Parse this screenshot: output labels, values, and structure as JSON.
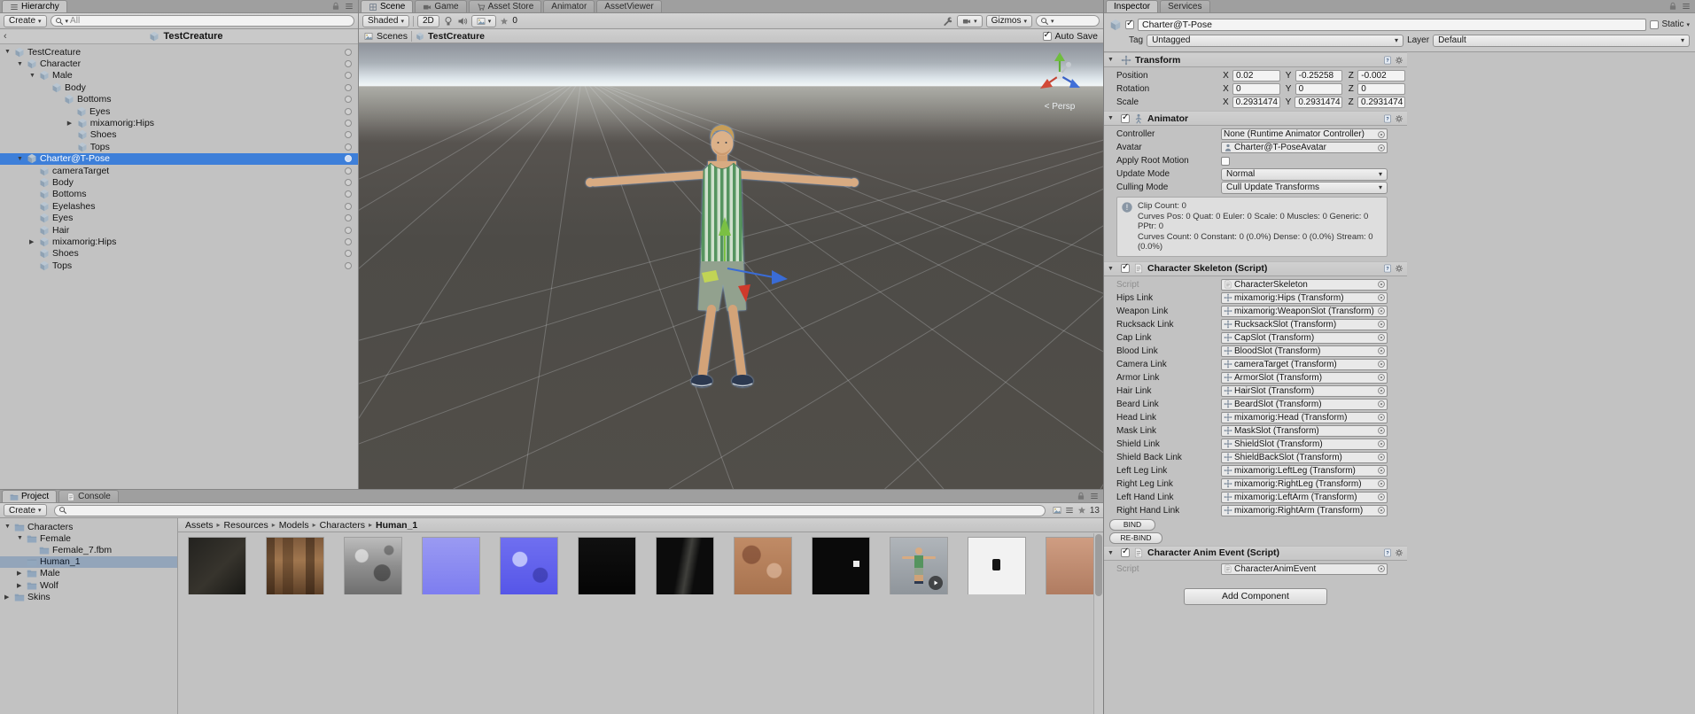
{
  "colors": {
    "selection_blue": "#3d7fd9",
    "project_selection": "#93a5ba",
    "gizmo_green": "#7ac043",
    "gizmo_red": "#cf3a2c",
    "gizmo_blue": "#3a6cd6",
    "shirt_green": "#55945f"
  },
  "hierarchy": {
    "tab": "Hierarchy",
    "create_button": "Create",
    "search_value": "All",
    "header_title": "TestCreature",
    "tree": [
      {
        "label": "TestCreature"
      },
      {
        "label": "Character"
      },
      {
        "label": "Male"
      },
      {
        "label": "Body"
      },
      {
        "label": "Bottoms"
      },
      {
        "label": "Eyes"
      },
      {
        "label": "mixamorig:Hips"
      },
      {
        "label": "Shoes"
      },
      {
        "label": "Tops"
      },
      {
        "label": "Charter@T-Pose",
        "selected": true
      },
      {
        "label": "cameraTarget"
      },
      {
        "label": "Body"
      },
      {
        "label": "Bottoms"
      },
      {
        "label": "Eyelashes"
      },
      {
        "label": "Eyes"
      },
      {
        "label": "Hair"
      },
      {
        "label": "mixamorig:Hips"
      },
      {
        "label": "Shoes"
      },
      {
        "label": "Tops"
      }
    ]
  },
  "scene": {
    "tabs": [
      "Scene",
      "Game",
      "Asset Store",
      "Animator",
      "AssetViewer"
    ],
    "toolbar": {
      "shading": "Shaded",
      "mode_2d": "2D",
      "fx_count": "0",
      "gizmos": "Gizmos"
    },
    "breadcrumb": {
      "scenes_label": "Scenes",
      "scene_name": "TestCreature",
      "autosave_label": "Auto Save"
    },
    "viewport": {
      "persp_label": "< Persp"
    }
  },
  "inspector": {
    "tabs": [
      "Inspector",
      "Services"
    ],
    "header": {
      "name": "Charter@T-Pose",
      "static_label": "Static",
      "tag_label": "Tag",
      "tag_value": "Untagged",
      "layer_label": "Layer",
      "layer_value": "Default"
    },
    "axis_labels": [
      "X",
      "Y",
      "Z"
    ],
    "transform": {
      "title": "Transform",
      "rows": [
        {
          "label": "Position",
          "x": "0.02",
          "y": "-0.25258",
          "z": "-0.002"
        },
        {
          "label": "Rotation",
          "x": "0",
          "y": "0",
          "z": "0"
        },
        {
          "label": "Scale",
          "x": "0.2931474",
          "y": "0.2931474",
          "z": "0.2931474"
        }
      ]
    },
    "animator": {
      "title": "Animator",
      "labels": {
        "controller": "Controller",
        "avatar": "Avatar",
        "root_motion": "Apply Root Motion",
        "update_mode": "Update Mode",
        "culling_mode": "Culling Mode"
      },
      "controller_value": "None (Runtime Animator Controller)",
      "avatar_value": "Charter@T-PoseAvatar",
      "update_mode_value": "Normal",
      "culling_mode_value": "Cull Update Transforms",
      "info_lines": [
        "Clip Count: 0",
        "Curves Pos: 0 Quat: 0 Euler: 0 Scale: 0 Muscles: 0 Generic: 0",
        "PPtr: 0",
        "Curves Count: 0 Constant: 0 (0.0%) Dense: 0 (0.0%) Stream: 0 (0.0%)"
      ]
    },
    "skeleton": {
      "title": "Character Skeleton (Script)",
      "script_label": "Script",
      "script_value": "CharacterSkeleton",
      "rows": [
        {
          "label": "Hips Link",
          "value": "mixamorig:Hips (Transform)"
        },
        {
          "label": "Weapon Link",
          "value": "mixamorig:WeaponSlot (Transform)"
        },
        {
          "label": "Rucksack Link",
          "value": "RucksackSlot (Transform)"
        },
        {
          "label": "Cap Link",
          "value": "CapSlot (Transform)"
        },
        {
          "label": "Blood Link",
          "value": "BloodSlot (Transform)"
        },
        {
          "label": "Camera Link",
          "value": "cameraTarget (Transform)"
        },
        {
          "label": "Armor Link",
          "value": "ArmorSlot (Transform)"
        },
        {
          "label": "Hair Link",
          "value": "HairSlot (Transform)"
        },
        {
          "label": "Beard Link",
          "value": "BeardSlot (Transform)"
        },
        {
          "label": "Head Link",
          "value": "mixamorig:Head (Transform)"
        },
        {
          "label": "Mask Link",
          "value": "MaskSlot (Transform)"
        },
        {
          "label": "Shield Link",
          "value": "ShieldSlot (Transform)"
        },
        {
          "label": "Shield Back Link",
          "value": "ShieldBackSlot (Transform)"
        },
        {
          "label": "Left Leg Link",
          "value": "mixamorig:LeftLeg (Transform)"
        },
        {
          "label": "Right Leg Link",
          "value": "mixamorig:RightLeg (Transform)"
        },
        {
          "label": "Left Hand Link",
          "value": "mixamorig:LeftArm (Transform)"
        },
        {
          "label": "Right Hand Link",
          "value": "mixamorig:RightArm (Transform)"
        }
      ],
      "bind_button": "BIND",
      "rebind_button": "RE-BIND"
    },
    "anim_event": {
      "title": "Character Anim Event (Script)",
      "script_label": "Script",
      "script_value": "CharacterAnimEvent"
    },
    "add_component": "Add Component"
  },
  "project": {
    "tabs": [
      "Project",
      "Console"
    ],
    "create_button": "Create",
    "asset_count": "13",
    "folders": [
      {
        "label": "Characters"
      },
      {
        "label": "Female"
      },
      {
        "label": "Female_7.fbm"
      },
      {
        "label": "Human_1",
        "selected": true
      },
      {
        "label": "Male"
      },
      {
        "label": "Wolf"
      },
      {
        "label": "Skins"
      }
    ],
    "breadcrumb": [
      "Assets",
      "Resources",
      "Models",
      "Characters",
      "Human_1"
    ],
    "thumbs": [
      {
        "name": "texture-dark",
        "bg": "linear-gradient(135deg,#23221f,#37342d 55%,#181815)"
      },
      {
        "name": "texture-hair-atlas",
        "bg": "linear-gradient(180deg,#7e5a3c,#a0764e 40%,#5d4028)"
      },
      {
        "name": "texture-cloth-gray",
        "bg": "linear-gradient(180deg,#bcbcbc,#8e8e8e 50%,#6f6f6f)"
      },
      {
        "name": "normal-map-light",
        "bg": "linear-gradient(180deg,#9a9af2,#7d7df0)"
      },
      {
        "name": "normal-map",
        "bg": "linear-gradient(180deg,#6f6ff0,#5656e8)"
      },
      {
        "name": "texture-black",
        "bg": "linear-gradient(180deg,#101010,#050505)"
      },
      {
        "name": "texture-black-streak",
        "bg": "linear-gradient(100deg,#0c0c0c 40%,#40403c 54%,#0c0c0c 68%)"
      },
      {
        "name": "texture-skin-atlas",
        "bg": "linear-gradient(180deg,#c08b66,#a8734f)"
      },
      {
        "name": "texture-black-mark",
        "bg": "#0a0a0a"
      },
      {
        "name": "model-preview",
        "bg": "linear-gradient(180deg,#b0b5ba,#8f959b)"
      },
      {
        "name": "texture-white",
        "bg": "#f2f2f2"
      },
      {
        "name": "texture-face",
        "bg": "linear-gradient(180deg,#cf9d82,#b07c61)"
      }
    ]
  }
}
